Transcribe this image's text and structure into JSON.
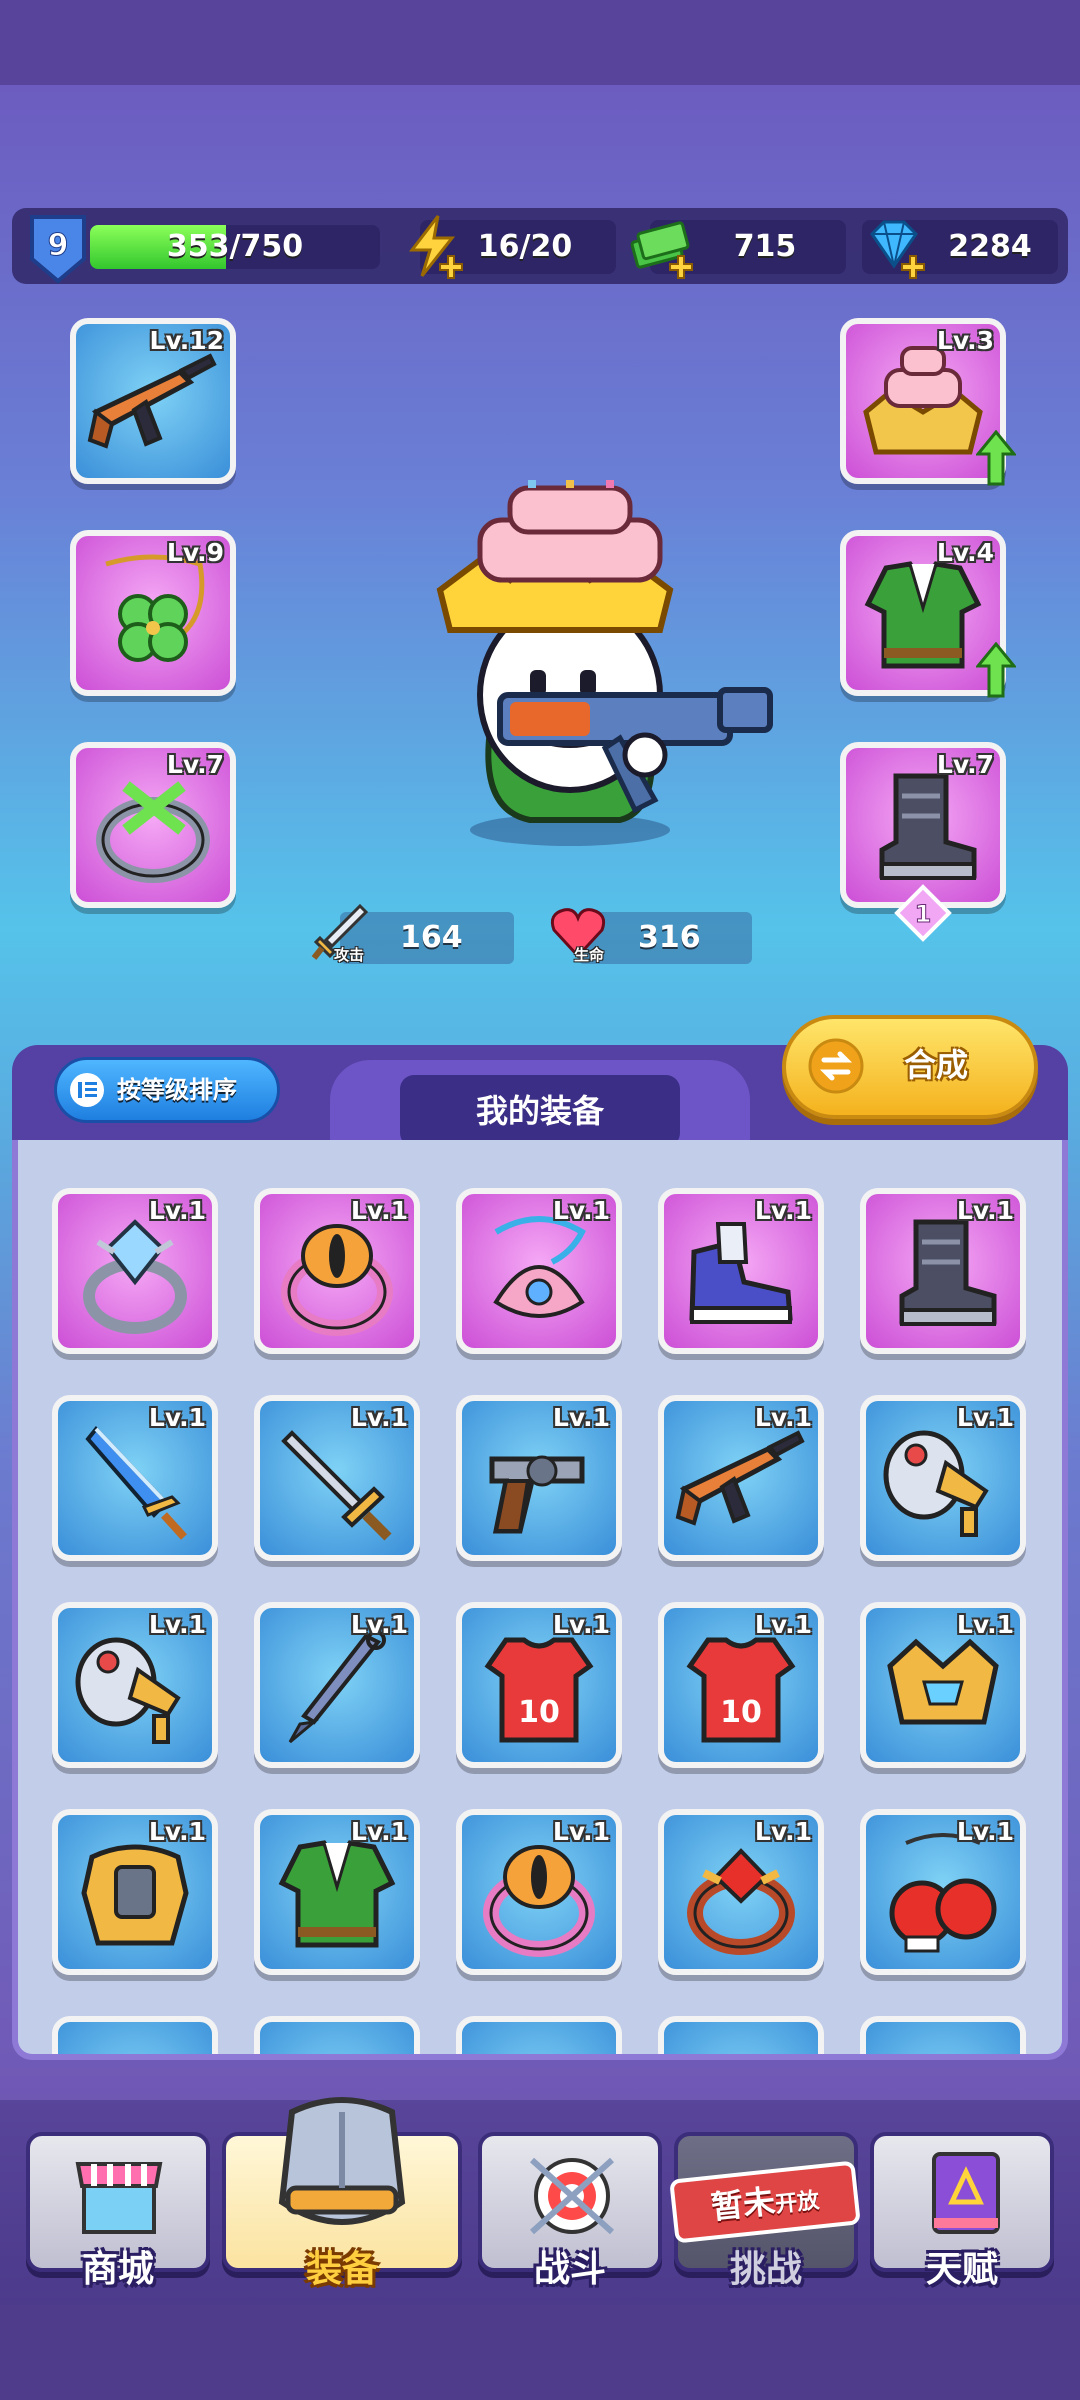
{
  "player": {
    "level": "9",
    "xp_text": "353/750",
    "xp_fraction": 0.47
  },
  "resources": {
    "energy": "16/20",
    "cash": "715",
    "gems": "2284"
  },
  "equipped": {
    "left": [
      {
        "level": "Lv.12",
        "item": "rifle-icon",
        "rarity": "blue"
      },
      {
        "level": "Lv.9",
        "item": "clover-necklace-icon",
        "rarity": "pink"
      },
      {
        "level": "Lv.7",
        "item": "ring-icon",
        "rarity": "pink"
      }
    ],
    "right": [
      {
        "level": "Lv.3",
        "item": "cake-crown-icon",
        "rarity": "pink",
        "upgrade": true
      },
      {
        "level": "Lv.4",
        "item": "green-jacket-icon",
        "rarity": "pink",
        "upgrade": true
      },
      {
        "level": "Lv.7",
        "item": "boots-icon",
        "rarity": "pink",
        "badge": "1"
      }
    ]
  },
  "stats": {
    "attack_label": "攻击",
    "attack_value": "164",
    "hp_label": "生命",
    "hp_value": "316"
  },
  "inventory": {
    "sort_label": "按等级排序",
    "title": "我的装备",
    "synth_label": "合成",
    "rows": [
      [
        {
          "level": "Lv.1",
          "item": "crystal-ring-icon",
          "rarity": "pink"
        },
        {
          "level": "Lv.1",
          "item": "eye-ring-icon",
          "rarity": "pink"
        },
        {
          "level": "Lv.1",
          "item": "shell-necklace-icon",
          "rarity": "pink"
        },
        {
          "level": "Lv.1",
          "item": "sneaker-icon",
          "rarity": "pink"
        },
        {
          "level": "Lv.1",
          "item": "boots-icon",
          "rarity": "pink"
        }
      ],
      [
        {
          "level": "Lv.1",
          "item": "dagger-icon",
          "rarity": "blue"
        },
        {
          "level": "Lv.1",
          "item": "sword-icon",
          "rarity": "blue"
        },
        {
          "level": "Lv.1",
          "item": "revolver-icon",
          "rarity": "blue"
        },
        {
          "level": "Lv.1",
          "item": "rifle-icon",
          "rarity": "blue"
        },
        {
          "level": "Lv.1",
          "item": "megaphone-icon",
          "rarity": "blue"
        }
      ],
      [
        {
          "level": "Lv.1",
          "item": "megaphone-icon",
          "rarity": "blue"
        },
        {
          "level": "Lv.1",
          "item": "kunai-icon",
          "rarity": "blue"
        },
        {
          "level": "Lv.1",
          "item": "jersey-icon",
          "rarity": "blue"
        },
        {
          "level": "Lv.1",
          "item": "jersey-icon",
          "rarity": "blue"
        },
        {
          "level": "Lv.1",
          "item": "crown-icon",
          "rarity": "blue"
        }
      ],
      [
        {
          "level": "Lv.1",
          "item": "armor-icon",
          "rarity": "blue"
        },
        {
          "level": "Lv.1",
          "item": "green-jacket-icon",
          "rarity": "blue"
        },
        {
          "level": "Lv.1",
          "item": "eye-ring-icon",
          "rarity": "blue"
        },
        {
          "level": "Lv.1",
          "item": "ruby-ring-icon",
          "rarity": "blue"
        },
        {
          "level": "Lv.1",
          "item": "boxing-gloves-icon",
          "rarity": "blue"
        }
      ]
    ]
  },
  "nav": {
    "shop": "商城",
    "equip": "装备",
    "battle": "战斗",
    "challenge": "挑战",
    "talent": "天赋",
    "locked_tag": "暂未",
    "locked_tag_small": "开放"
  },
  "colors": {
    "pink_slot": "#cc4fd6",
    "blue_slot": "#3a8fd9",
    "accent_yellow": "#f4b21e"
  }
}
